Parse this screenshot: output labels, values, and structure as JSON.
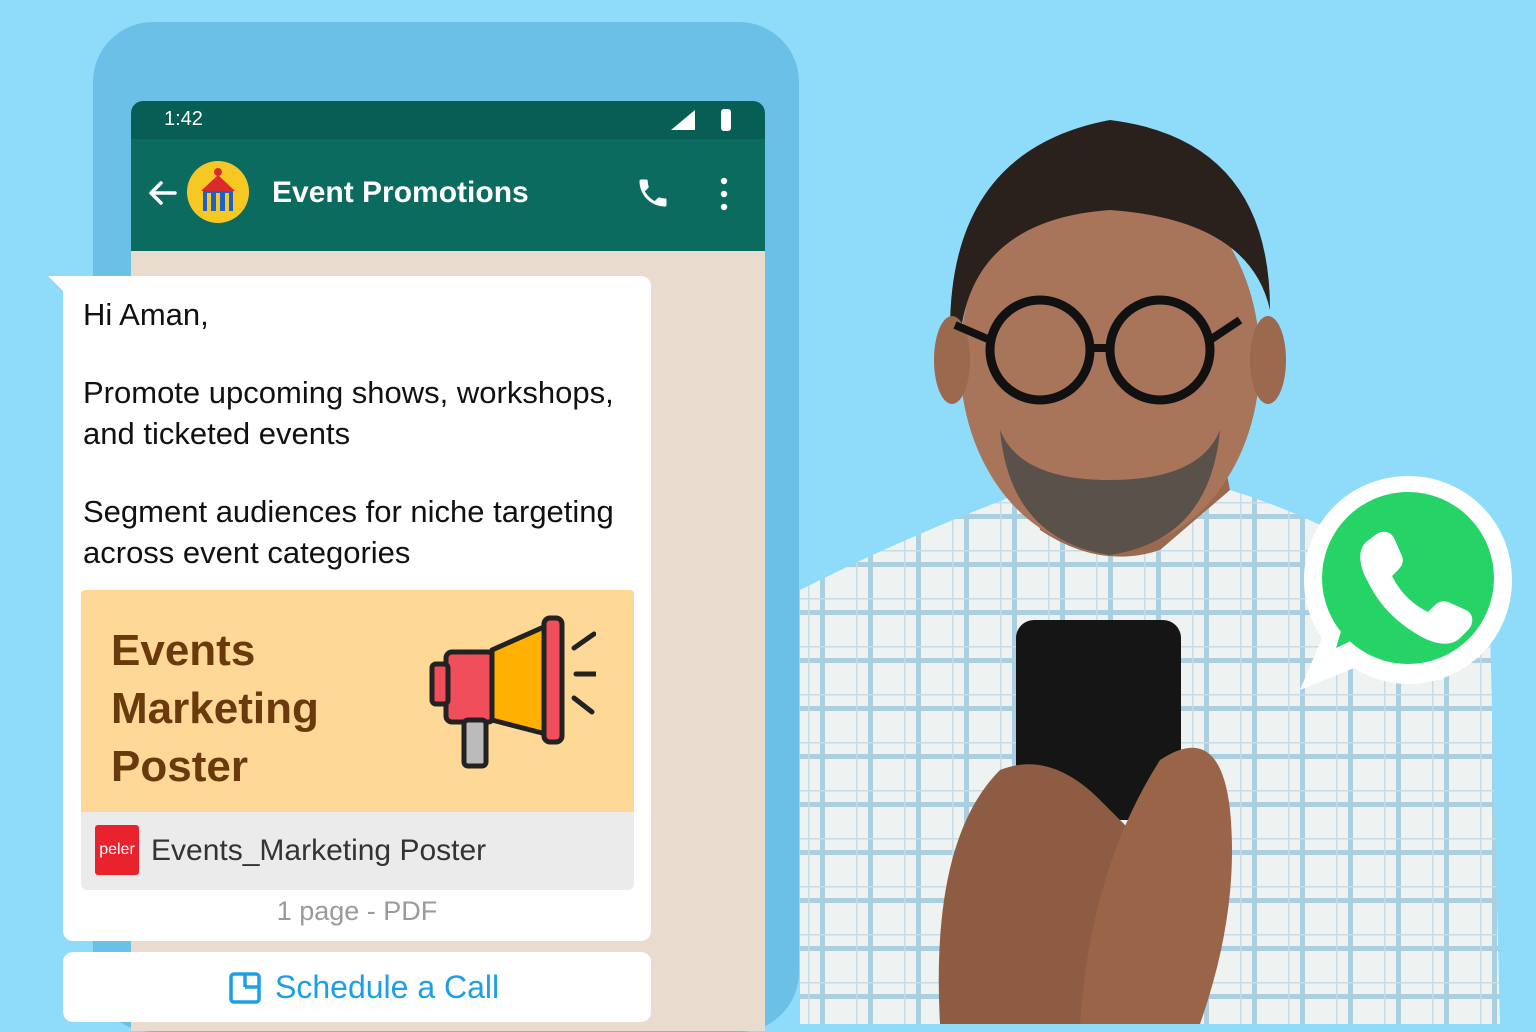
{
  "status_bar": {
    "time": "1:42"
  },
  "chat": {
    "title": "Event Promotions"
  },
  "message": {
    "greeting": "Hi Aman,",
    "paragraph1": "Promote upcoming shows, workshops, and ticketed events",
    "paragraph2": "Segment audiences for niche targeting across event categories"
  },
  "attachment": {
    "poster_title_lines": [
      "Events",
      "Marketing",
      "Poster"
    ],
    "pdf_icon_text": "peler",
    "file_name": "Events_Marketing Poster",
    "meta": "1 page - PDF"
  },
  "cta": {
    "label": "Schedule a Call"
  },
  "icons": {
    "back": "arrow-left-icon",
    "call": "phone-icon",
    "menu": "more-vertical-icon",
    "megaphone": "megaphone-icon",
    "cta": "calendar-icon",
    "logo": "whatsapp-logo-icon"
  },
  "colors": {
    "header": "#0b6b5e",
    "accent": "#1d9fe6",
    "whatsapp": "#25d366"
  }
}
